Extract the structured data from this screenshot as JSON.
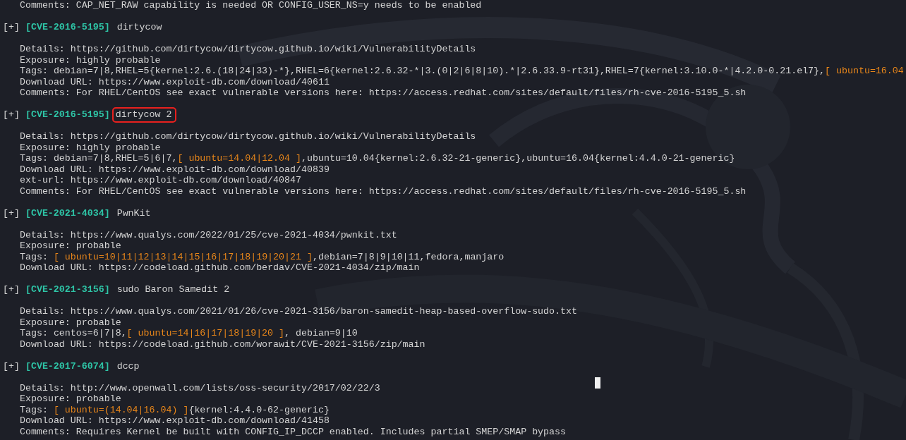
{
  "terminal": {
    "previous_tail": [
      {
        "text": "Comments: CAP_NET_RAW capability is needed OR CONFIG_USER_NS=y needs to be enabled"
      }
    ],
    "entries": [
      {
        "prefix": "[+]",
        "cve": "[CVE-2016-5195]",
        "name": "dirtycow",
        "highlighted": false,
        "lines": [
          [
            {
              "text": "Details: https://github.com/dirtycow/dirtycow.github.io/wiki/VulnerabilityDetails"
            }
          ],
          [
            {
              "text": "Exposure: highly probable"
            }
          ],
          [
            {
              "text": "Tags: debian=7|8,RHEL=5{kernel:2.6.(18|24|33)-*},RHEL=6{kernel:2.6.32-*|3.(0|2|6|8|10).*|2.6.33.9-rt31},RHEL=7{kernel:3.10.0-*|4.2.0-0.21.el7},"
            },
            {
              "text": "[ ubuntu=16.04",
              "kind": "match"
            }
          ],
          [
            {
              "text": "Download URL: https://www.exploit-db.com/download/40611"
            }
          ],
          [
            {
              "text": "Comments: For RHEL/CentOS see exact vulnerable versions here: https://access.redhat.com/sites/default/files/rh-cve-2016-5195_5.sh"
            }
          ]
        ]
      },
      {
        "prefix": "[+]",
        "cve": "[CVE-2016-5195]",
        "name": "dirtycow 2",
        "highlighted": true,
        "lines": [
          [
            {
              "text": "Details: https://github.com/dirtycow/dirtycow.github.io/wiki/VulnerabilityDetails"
            }
          ],
          [
            {
              "text": "Exposure: highly probable"
            }
          ],
          [
            {
              "text": "Tags: debian=7|8,RHEL=5|6|7,"
            },
            {
              "text": "[ ubuntu=14.04|12.04 ]",
              "kind": "match"
            },
            {
              "text": ",ubuntu=10.04{kernel:2.6.32-21-generic},ubuntu=16.04{kernel:4.4.0-21-generic}"
            }
          ],
          [
            {
              "text": "Download URL: https://www.exploit-db.com/download/40839"
            }
          ],
          [
            {
              "text": "ext-url: https://www.exploit-db.com/download/40847"
            }
          ],
          [
            {
              "text": "Comments: For RHEL/CentOS see exact vulnerable versions here: https://access.redhat.com/sites/default/files/rh-cve-2016-5195_5.sh"
            }
          ]
        ]
      },
      {
        "prefix": "[+]",
        "cve": "[CVE-2021-4034]",
        "name": "PwnKit",
        "highlighted": false,
        "lines": [
          [
            {
              "text": "Details: https://www.qualys.com/2022/01/25/cve-2021-4034/pwnkit.txt"
            }
          ],
          [
            {
              "text": "Exposure: probable"
            }
          ],
          [
            {
              "text": "Tags: "
            },
            {
              "text": "[ ubuntu=10|11|12|13|14|15|16|17|18|19|20|21 ]",
              "kind": "match"
            },
            {
              "text": ",debian=7|8|9|10|11,fedora,manjaro"
            }
          ],
          [
            {
              "text": "Download URL: https://codeload.github.com/berdav/CVE-2021-4034/zip/main"
            }
          ]
        ]
      },
      {
        "prefix": "[+]",
        "cve": "[CVE-2021-3156]",
        "name": "sudo Baron Samedit 2",
        "highlighted": false,
        "lines": [
          [
            {
              "text": "Details: https://www.qualys.com/2021/01/26/cve-2021-3156/baron-samedit-heap-based-overflow-sudo.txt"
            }
          ],
          [
            {
              "text": "Exposure: probable"
            }
          ],
          [
            {
              "text": "Tags: centos=6|7|8,"
            },
            {
              "text": "[ ubuntu=14|16|17|18|19|20 ]",
              "kind": "match"
            },
            {
              "text": ", debian=9|10"
            }
          ],
          [
            {
              "text": "Download URL: https://codeload.github.com/worawit/CVE-2021-3156/zip/main"
            }
          ]
        ]
      },
      {
        "prefix": "[+]",
        "cve": "[CVE-2017-6074]",
        "name": "dccp",
        "highlighted": false,
        "lines": [
          [
            {
              "text": "Details: http://www.openwall.com/lists/oss-security/2017/02/22/3"
            }
          ],
          [
            {
              "text": "Exposure: probable"
            }
          ],
          [
            {
              "text": "Tags: "
            },
            {
              "text": "[ ubuntu=(14.04|16.04) ]",
              "kind": "match"
            },
            {
              "text": "{kernel:4.4.0-62-generic}"
            }
          ],
          [
            {
              "text": "Download URL: https://www.exploit-db.com/download/41458"
            }
          ],
          [
            {
              "text": "Comments: Requires Kernel be built with CONFIG_IP_DCCP enabled. Includes partial SMEP/SMAP bypass"
            }
          ]
        ]
      }
    ],
    "cursor_visible": true
  }
}
